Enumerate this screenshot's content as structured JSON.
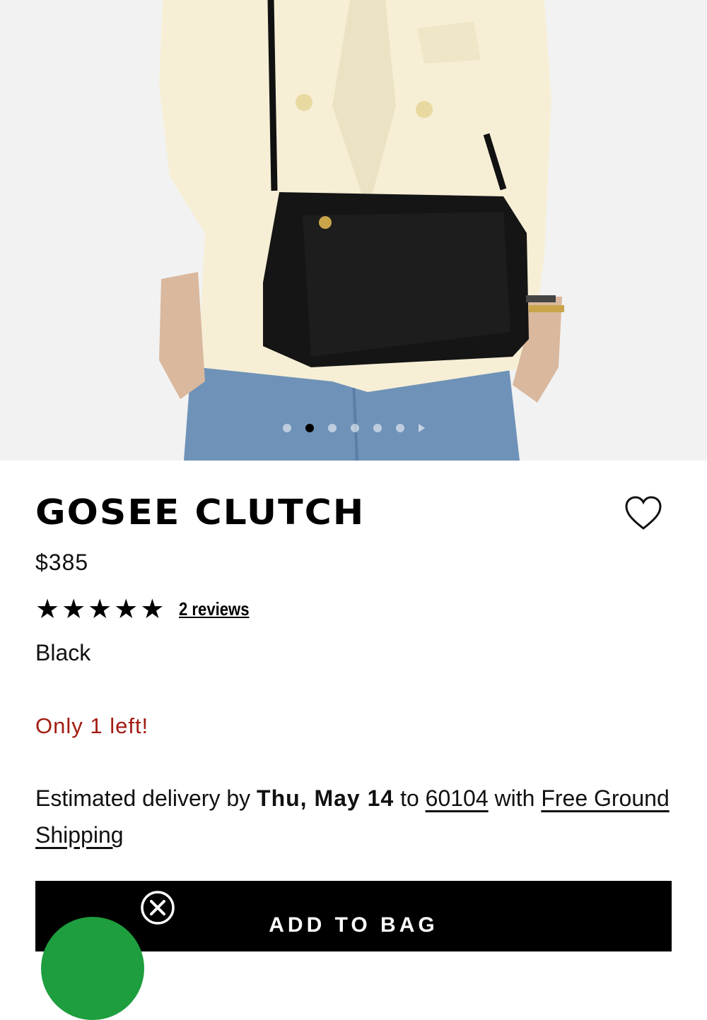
{
  "product": {
    "title": "GOSEE CLUTCH",
    "price": "$385",
    "rating_stars": 5,
    "reviews_link": "2 reviews",
    "color": "Black",
    "stock_notice": "Only 1 left!"
  },
  "gallery": {
    "image_count": 6,
    "active_index": 1,
    "next_icon": "triangle-right-icon"
  },
  "delivery": {
    "prefix": "Estimated delivery by ",
    "date": "Thu, May 14",
    "to_text": " to ",
    "zip": "60104",
    "with_text": " with ",
    "shipping": "Free Ground Shipping"
  },
  "actions": {
    "add_to_bag": "ADD TO BAG",
    "favorite_icon": "heart-outline-icon",
    "close_icon": "close-circle-icon"
  },
  "colors": {
    "stock_red": "#a21c12",
    "button_bg": "#000000",
    "chat_green": "#1e9e3e"
  }
}
